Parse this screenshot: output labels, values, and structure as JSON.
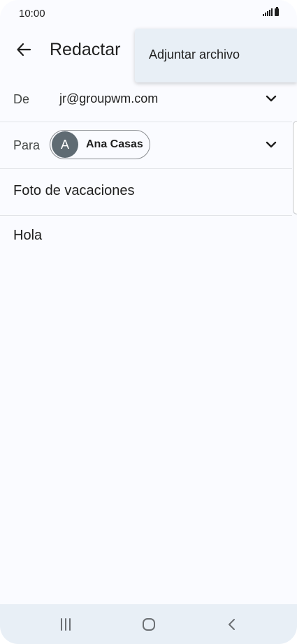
{
  "status_bar": {
    "time": "10:00",
    "icons": [
      "signal-icon",
      "battery-icon"
    ]
  },
  "app_bar": {
    "back_icon": "arrow-left-icon",
    "title": "Redactar"
  },
  "overflow_menu": {
    "items": [
      {
        "label": "Adjuntar archivo"
      }
    ]
  },
  "compose": {
    "from": {
      "label": "De",
      "value": "jr@groupwm.com",
      "icon": "chevron-down-icon"
    },
    "to": {
      "label": "Para",
      "recipient": {
        "initial": "A",
        "name": "Ana Casas"
      },
      "icon": "chevron-down-icon"
    },
    "subject": "Foto de vacaciones",
    "body": "Hola"
  },
  "nav_bar": {
    "icons": [
      "recent-apps-icon",
      "home-icon",
      "back-icon"
    ]
  },
  "colors": {
    "background": "#fafbff",
    "menu_background": "#e8eff6",
    "avatar": "#5f6b73",
    "divider": "#e2e4e8"
  }
}
